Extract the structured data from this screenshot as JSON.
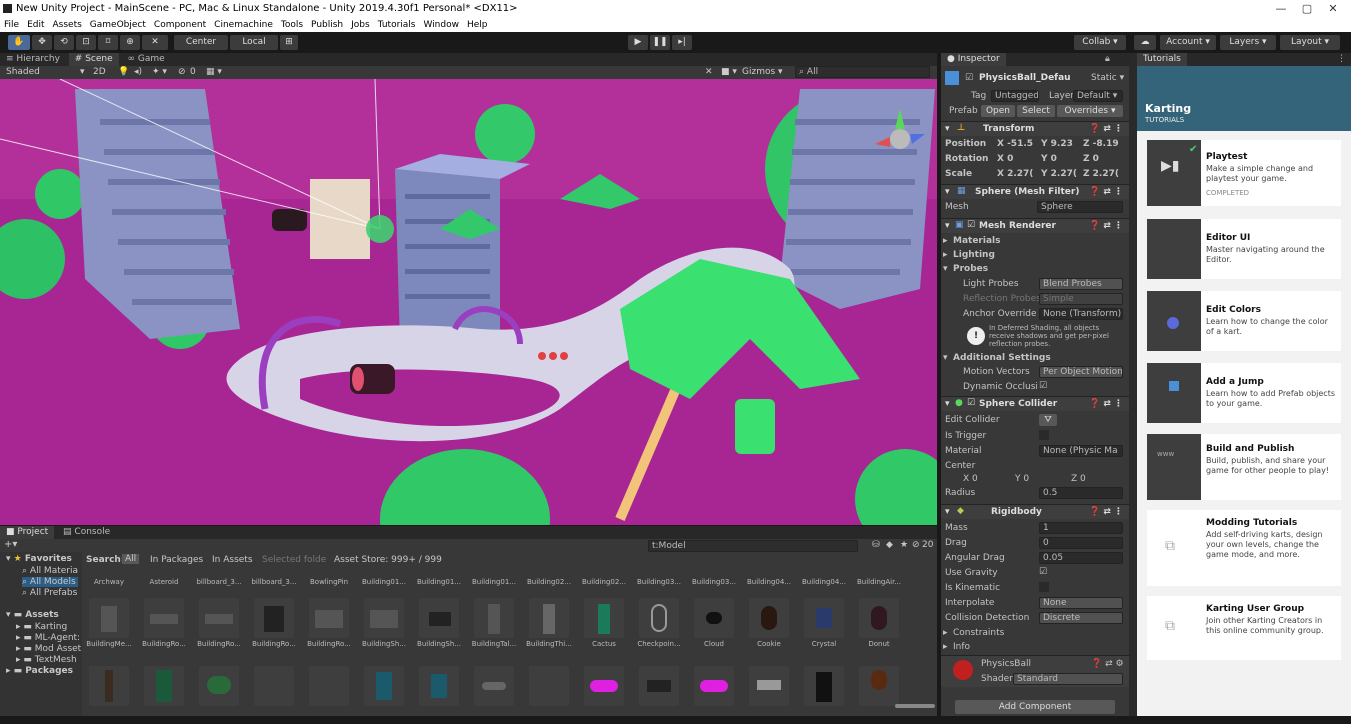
{
  "titlebar": {
    "title": "New Unity Project - MainScene - PC, Mac & Linux Standalone - Unity 2019.4.30f1 Personal* <DX11>",
    "minimize": "—",
    "maximize": "▢",
    "close": "✕"
  },
  "menu": [
    "File",
    "Edit",
    "Assets",
    "GameObject",
    "Component",
    "Cinemachine",
    "Tools",
    "Publish",
    "Jobs",
    "Tutorials",
    "Window",
    "Help"
  ],
  "toolbar": {
    "center": "Center",
    "local": "Local",
    "collab": "Collab ▾",
    "account": "Account ▾",
    "layers": "Layers ▾",
    "layout": "Layout ▾"
  },
  "tabs": {
    "hierarchy": "Hierarchy",
    "scene": "Scene",
    "game": "Game",
    "inspector": "Inspector",
    "tutorials": "Tutorials",
    "project": "Project",
    "console": "Console"
  },
  "scenebar": {
    "shading": "Shaded",
    "mode2d": "2D",
    "gizmos": "Gizmos ▾",
    "search": "All",
    "layers_count": "0"
  },
  "inspector": {
    "object_name": "PhysicsBall_Defau",
    "static": "Static ▾",
    "tag_label": "Tag",
    "tag": "Untagged ▾",
    "layer_label": "Layer",
    "layer": "Default ▾",
    "prefab": "Prefab",
    "open": "Open",
    "select": "Select",
    "overrides": "Overrides ▾",
    "transform": "Transform",
    "position": {
      "label": "Position",
      "x": "X -51.5",
      "y": "Y 9.23",
      "z": "Z -8.19"
    },
    "rotation": {
      "label": "Rotation",
      "x": "X 0",
      "y": "Y 0",
      "z": "Z 0"
    },
    "scale": {
      "label": "Scale",
      "x": "X 2.27(",
      "y": "Y 2.27(",
      "z": "Z 2.27("
    },
    "mesh_filter": "Sphere (Mesh Filter)",
    "mesh_label": "Mesh",
    "mesh": "Sphere",
    "mesh_renderer": "Mesh Renderer",
    "materials": "Materials",
    "lighting": "Lighting",
    "probes": "Probes",
    "light_probes_label": "Light Probes",
    "light_probes": "Blend Probes",
    "reflection_probes_label": "Reflection Probes",
    "reflection_probes": "Simple",
    "anchor_label": "Anchor Override",
    "anchor": "None (Transform)",
    "info": "In Deferred Shading, all objects receive shadows and get per-pixel reflection probes.",
    "additional": "Additional Settings",
    "motion_label": "Motion Vectors",
    "motion": "Per Object Motion",
    "dyn_label": "Dynamic Occlusion",
    "sphere_collider": "Sphere Collider",
    "edit_collider": "Edit Collider",
    "is_trigger": "Is Trigger",
    "material_label": "Material",
    "material": "None (Physic Ma",
    "center_label": "Center",
    "cx": "X 0",
    "cy": "Y 0",
    "cz": "Z 0",
    "radius_label": "Radius",
    "radius": "0.5",
    "rigidbody": "Rigidbody",
    "mass_label": "Mass",
    "mass": "1",
    "drag_label": "Drag",
    "drag": "0",
    "ang_label": "Angular Drag",
    "ang": "0.05",
    "gravity_label": "Use Gravity",
    "kinematic_label": "Is Kinematic",
    "interp_label": "Interpolate",
    "interp": "None",
    "coll_label": "Collision Detection",
    "coll": "Discrete",
    "constraints": "Constraints",
    "info_fold": "Info",
    "material_name": "PhysicsBall",
    "shader_label": "Shader",
    "shader": "Standard",
    "add_component": "Add Component"
  },
  "tutorials_panel": {
    "header_title": "Karting",
    "header_sub": "TUTORIALS",
    "cards": [
      {
        "title": "Playtest",
        "desc": "Make a simple change and playtest your game.",
        "status": "COMPLETED"
      },
      {
        "title": "Editor UI",
        "desc": "Master navigating around the Editor.",
        "status": ""
      },
      {
        "title": "Edit Colors",
        "desc": "Learn how to change the color of a kart.",
        "status": ""
      },
      {
        "title": "Add a Jump",
        "desc": "Learn how to add Prefab objects to your game.",
        "status": ""
      },
      {
        "title": "Build and Publish",
        "desc": "Build, publish, and share your game for other people to play!",
        "status": ""
      },
      {
        "title": "Modding Tutorials",
        "desc": "Add self-driving karts, design your own levels, change the game mode, and more.",
        "status": ""
      },
      {
        "title": "Karting User Group",
        "desc": "Join other Karting Creators in this online community group.",
        "status": ""
      }
    ]
  },
  "project": {
    "search": "t:Model",
    "search_label": "Search:",
    "scope_all": "All",
    "scope_packages": "In Packages",
    "scope_assets": "In Assets",
    "scope_selected": "Selected folde",
    "store": "Asset Store: 999+ / 999",
    "hidden_count": "20",
    "favorites": "Favorites",
    "fav_items": [
      "All Materia",
      "All Models",
      "All Prefabs"
    ],
    "assets": "Assets",
    "asset_folders": [
      "Karting",
      "ML-Agent:",
      "Mod Asset",
      "TextMesh"
    ],
    "packages": "Packages",
    "row1": [
      "Archway",
      "Asteroid",
      "billboard_3...",
      "billboard_3...",
      "BowlingPin",
      "Building01...",
      "Building01...",
      "Building01...",
      "Building02...",
      "Building02...",
      "Building03...",
      "Building03...",
      "Building04...",
      "Building04...",
      "BuildingAir..."
    ],
    "row2": [
      "BuildingMe...",
      "BuildingRo...",
      "BuildingRo...",
      "BuildingRo...",
      "BuildingRo...",
      "BuildingSh...",
      "BuildingSh...",
      "BuildingTal...",
      "BuildingThi...",
      "Cactus",
      "Checkpoin...",
      "Cloud",
      "Cookie",
      "Crystal",
      "Donut"
    ]
  },
  "colors": {
    "ground": "#b02a96",
    "track": "#d8d4e8",
    "palm": "#2ee06a",
    "building": "#7f8bb8",
    "accent": "#3d7bd6"
  }
}
